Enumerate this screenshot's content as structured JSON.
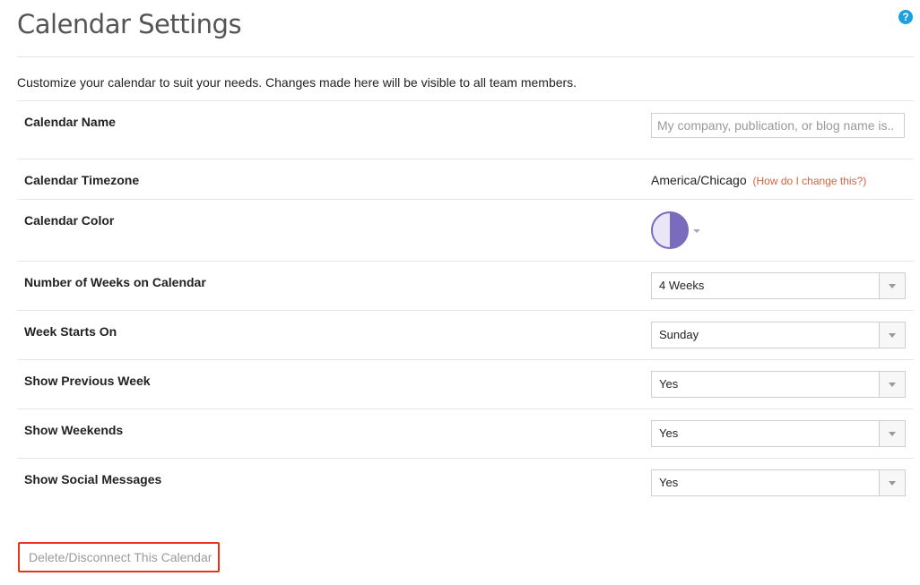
{
  "header": {
    "title": "Calendar Settings",
    "help_icon": "question-circle-icon",
    "help_glyph": "?",
    "intro": "Customize your calendar to suit your needs. Changes made here will be visible to all team members."
  },
  "settings": {
    "name": {
      "label": "Calendar Name",
      "value": "",
      "placeholder": "My company, publication, or blog name is.."
    },
    "timezone": {
      "label": "Calendar Timezone",
      "value": "America/Chicago",
      "link": "(How do I change this?)"
    },
    "color": {
      "label": "Calendar Color",
      "color_light": "#e9e6f6",
      "color_dark": "#7b6bbd"
    },
    "weeks": {
      "label": "Number of Weeks on Calendar",
      "value": "4 Weeks"
    },
    "week_start": {
      "label": "Week Starts On",
      "value": "Sunday"
    },
    "previous_week": {
      "label": "Show Previous Week",
      "value": "Yes"
    },
    "weekends": {
      "label": "Show Weekends",
      "value": "Yes"
    },
    "social": {
      "label": "Show Social Messages",
      "value": "Yes"
    }
  },
  "actions": {
    "delete_label": "Delete/Disconnect This Calendar",
    "highlight_color": "#e8341c",
    "link_color": "#d4633a"
  }
}
